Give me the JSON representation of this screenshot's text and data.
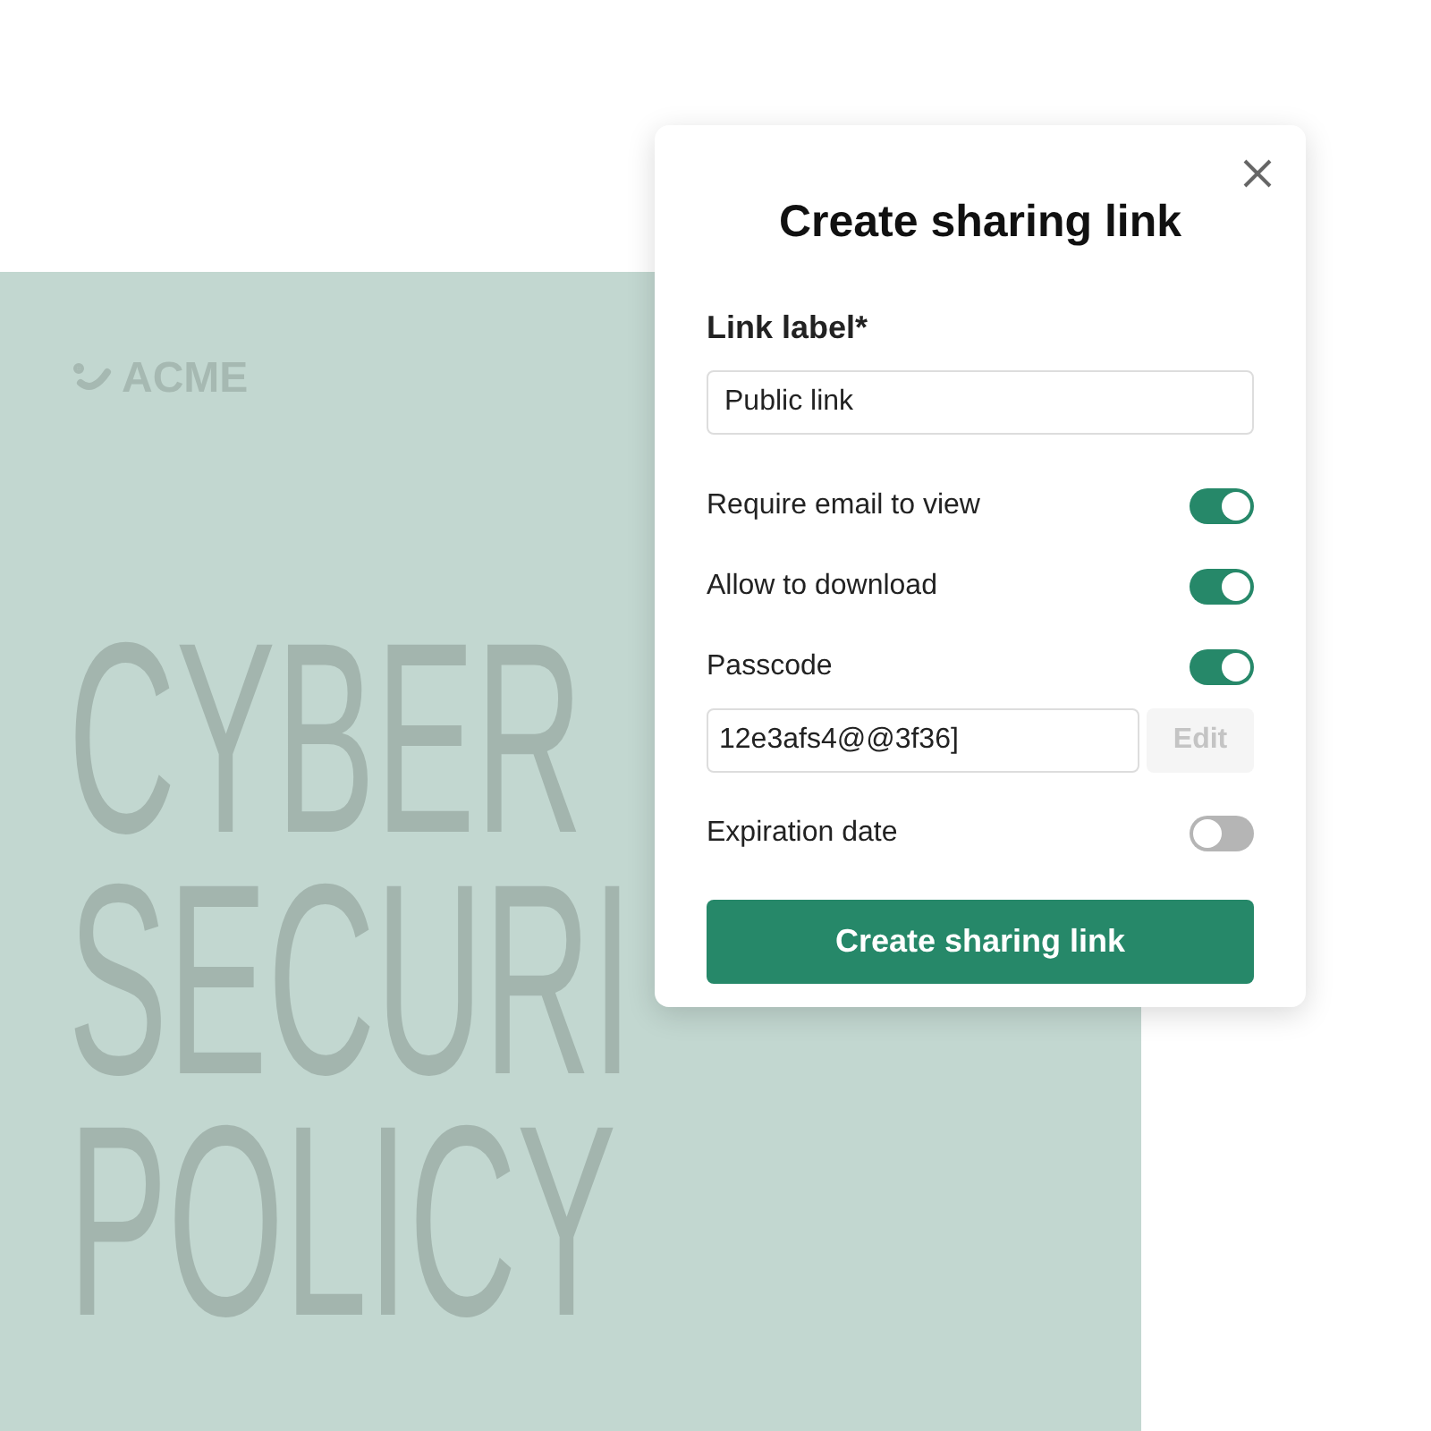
{
  "document": {
    "logo": "ACME",
    "title_lines": [
      "CYBER",
      "SECURI",
      "POLICY"
    ]
  },
  "dialog": {
    "title": "Create sharing link",
    "label_field": {
      "label": "Link label*",
      "value": "Public link"
    },
    "options": [
      {
        "kind": "toggle",
        "label": "Require email to view",
        "on": true
      },
      {
        "kind": "toggle",
        "label": "Allow to download",
        "on": true
      },
      {
        "kind": "toggle",
        "label": "Passcode",
        "on": true
      },
      {
        "kind": "passcode",
        "value": "12e3afs4@@3f36]",
        "button": "Edit",
        "disabled": true
      },
      {
        "kind": "toggle",
        "label": "Expiration date",
        "on": false
      }
    ],
    "submit": "Create sharing link"
  }
}
